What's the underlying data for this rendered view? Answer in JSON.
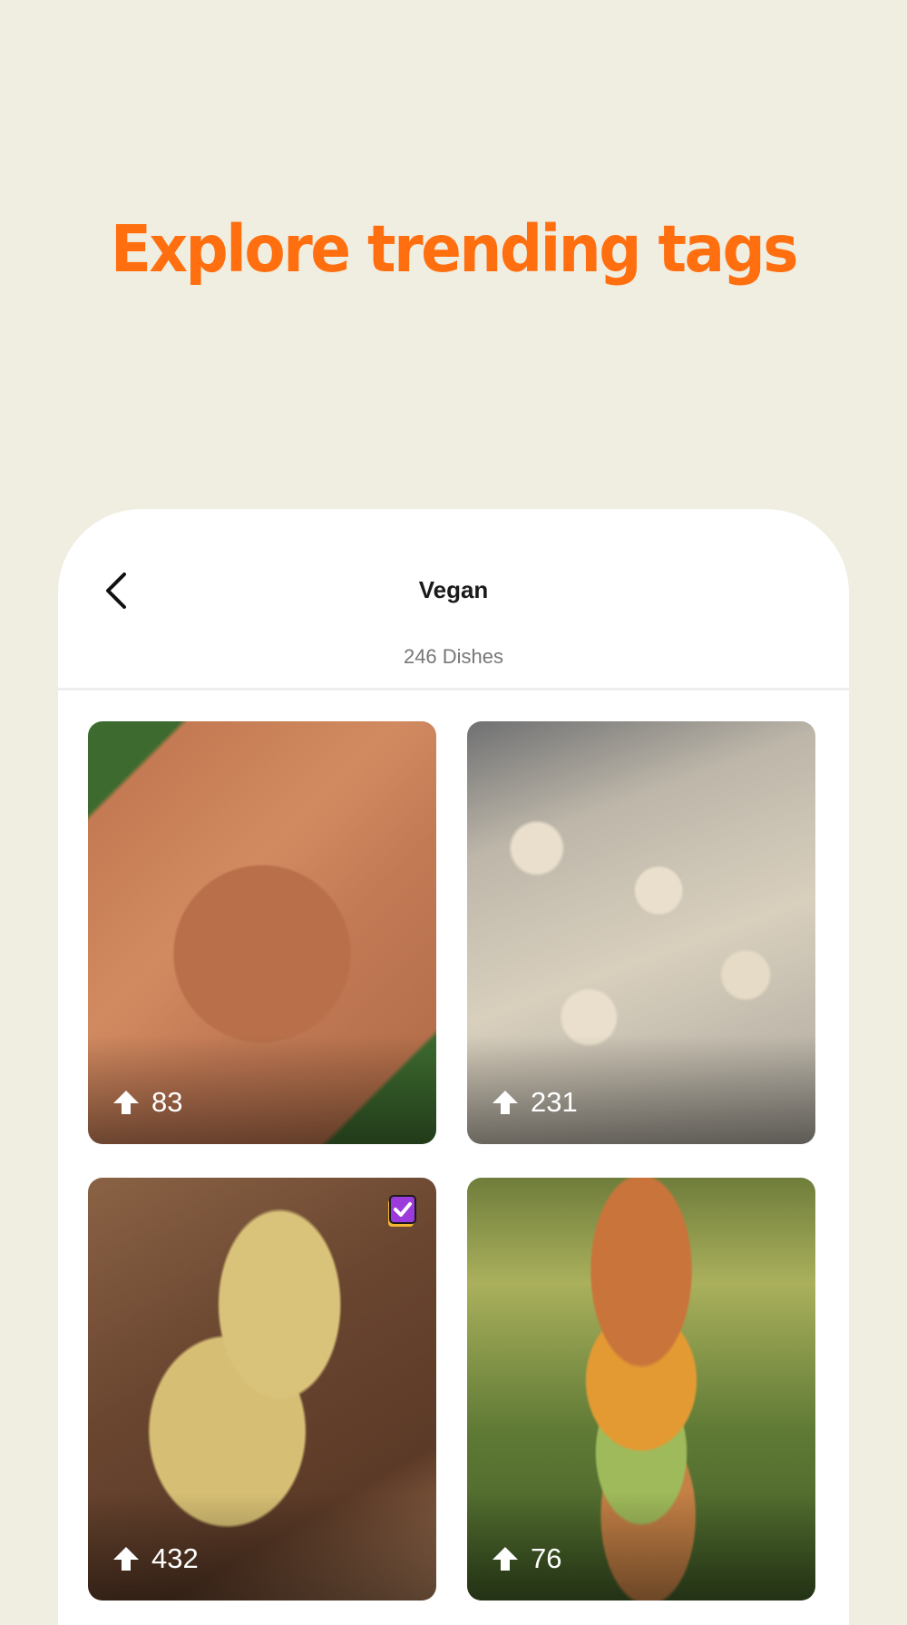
{
  "headline": "Explore trending tags",
  "screen": {
    "title": "Vegan",
    "subtitle": "246 Dishes"
  },
  "colors": {
    "background": "#f0ede1",
    "accent": "#ff6f0f",
    "card": "#ffffff",
    "badge": "#9b3bdb"
  },
  "dishes": [
    {
      "upvotes": "83",
      "icon": "upvote-arrow-icon",
      "badge": false
    },
    {
      "upvotes": "231",
      "icon": "upvote-arrow-icon",
      "badge": false
    },
    {
      "upvotes": "432",
      "icon": "upvote-arrow-icon",
      "badge": true,
      "badge_icon": "verified-check-icon"
    },
    {
      "upvotes": "76",
      "icon": "upvote-arrow-icon",
      "badge": false
    }
  ]
}
